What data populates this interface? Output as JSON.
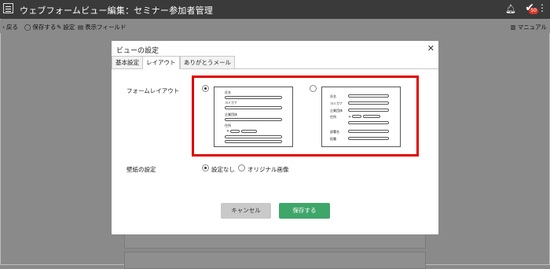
{
  "header": {
    "title": "ウェブフォームビュー編集：セミナー参加者管理",
    "badge_count": "50",
    "icons": [
      "hamburger-icon",
      "bell-icon",
      "check-icon",
      "more-vertical-icon"
    ]
  },
  "toolbar": {
    "back": "戻る",
    "save": "保存する",
    "settings": "設定",
    "display_fields": "表示フィールド",
    "manual": "マニュアル"
  },
  "dialog": {
    "title": "ビューの設定",
    "tabs": [
      {
        "label": "基本設定",
        "active": false
      },
      {
        "label": "レイアウト",
        "active": true
      },
      {
        "label": "ありがとうメール",
        "active": false
      }
    ],
    "form_layout_label": "フォームレイアウト",
    "layout_options": [
      {
        "selected": true,
        "fields": [
          "氏名",
          "ヨミガナ",
          "企業団体",
          "住所",
          "〒"
        ]
      },
      {
        "selected": false,
        "fields": [
          "氏名",
          "ヨミガナ",
          "企業団体",
          "住所",
          "〒",
          "部署名",
          "役職"
        ]
      }
    ],
    "wallpaper_label": "壁紙の設定",
    "wallpaper_options": [
      {
        "label": "設定なし",
        "selected": true
      },
      {
        "label": "オリジナル画像",
        "selected": false
      }
    ],
    "cancel_label": "キャンセル",
    "save_label": "保存する"
  },
  "colors": {
    "header_bg": "#3a3a3a",
    "overlay": "#8a8a8a",
    "save_button": "#3fa66a",
    "highlight": "#e00000",
    "badge": "#d9382a"
  }
}
